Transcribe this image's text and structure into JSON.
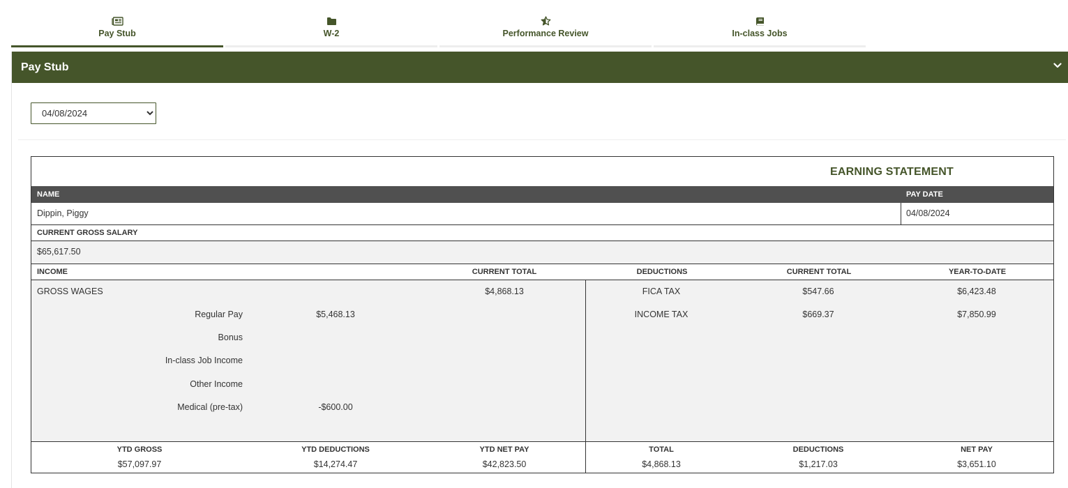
{
  "tabs": [
    {
      "label": "Pay Stub",
      "icon": "newspaper-icon",
      "active": true
    },
    {
      "label": "W-2",
      "icon": "folder-icon",
      "active": false
    },
    {
      "label": "Performance Review",
      "icon": "star-half-icon",
      "active": false
    },
    {
      "label": "In-class Jobs",
      "icon": "book-icon",
      "active": false
    }
  ],
  "panel": {
    "title": "Pay Stub",
    "date_select": {
      "value": "04/08/2024",
      "options": [
        "04/08/2024"
      ]
    }
  },
  "statement": {
    "title": "EARNING STATEMENT",
    "name_label": "NAME",
    "pay_date_label": "PAY DATE",
    "name": "Dippin, Piggy",
    "pay_date": "04/08/2024",
    "gross_salary_label": "CURRENT GROSS SALARY",
    "gross_salary": "$65,617.50",
    "columns": {
      "income": "INCOME",
      "current_total": "CURRENT TOTAL",
      "deductions": "DEDUCTIONS",
      "deductions_current_total": "CURRENT TOTAL",
      "year_to_date": "YEAR-TO-DATE"
    },
    "gross_wages": {
      "label": "GROSS WAGES",
      "value": "$4,868.13"
    },
    "income_items": [
      {
        "label": "Regular Pay",
        "value": "$5,468.13"
      },
      {
        "label": "Bonus",
        "value": ""
      },
      {
        "label": "In-class Job Income",
        "value": ""
      },
      {
        "label": "Other Income",
        "value": ""
      },
      {
        "label": "Medical (pre-tax)",
        "value": "-$600.00"
      }
    ],
    "deduction_items": [
      {
        "label": "FICA TAX",
        "current": "$547.66",
        "ytd": "$6,423.48"
      },
      {
        "label": "INCOME TAX",
        "current": "$669.37",
        "ytd": "$7,850.99"
      }
    ],
    "totals": {
      "ytd_gross_label": "YTD GROSS",
      "ytd_gross": "$57,097.97",
      "ytd_deductions_label": "YTD DEDUCTIONS",
      "ytd_deductions": "$14,274.47",
      "ytd_net_pay_label": "YTD NET PAY",
      "ytd_net_pay": "$42,823.50",
      "total_label": "TOTAL",
      "total": "$4,868.13",
      "deductions_label": "DEDUCTIONS",
      "deductions": "$1,217.03",
      "net_pay_label": "NET PAY",
      "net_pay": "$3,651.10"
    }
  }
}
